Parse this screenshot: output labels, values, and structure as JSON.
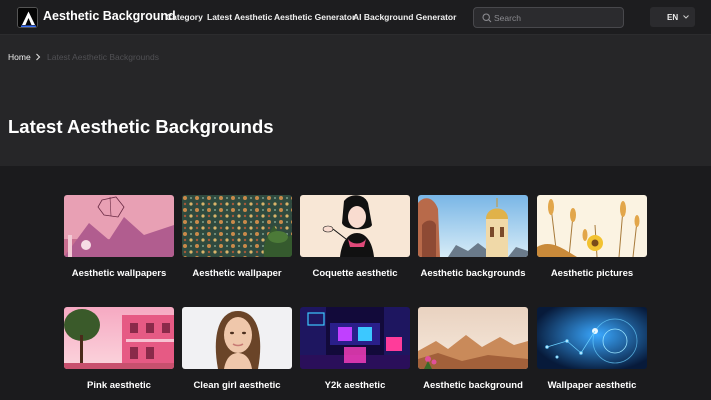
{
  "header": {
    "logo_name": "Aesthetic Background",
    "nav": [
      "Category",
      "Latest Aesthetic",
      "Aesthetic Generator",
      "AI Background Generator"
    ],
    "search_placeholder": "Search",
    "language": "EN"
  },
  "breadcrumb": {
    "home": "Home",
    "current": "Latest Aesthetic Backgrounds"
  },
  "page_title": "Latest Aesthetic Backgrounds",
  "cards": [
    {
      "title": "Aesthetic wallpapers",
      "thumb": "pink-crystal-room"
    },
    {
      "title": "Aesthetic wallpaper",
      "thumb": "floral-pattern-wall"
    },
    {
      "title": "Coquette aesthetic",
      "thumb": "coquette-girl-sketch"
    },
    {
      "title": "Aesthetic backgrounds",
      "thumb": "golden-domes"
    },
    {
      "title": "Aesthetic pictures",
      "thumb": "dried-flowers"
    },
    {
      "title": "Pink aesthetic",
      "thumb": "pink-houses"
    },
    {
      "title": "Clean girl aesthetic",
      "thumb": "girl-portrait"
    },
    {
      "title": "Y2k aesthetic",
      "thumb": "neon-room"
    },
    {
      "title": "Aesthetic background",
      "thumb": "desert-hills"
    },
    {
      "title": "Wallpaper aesthetic",
      "thumb": "blue-tech-circuit"
    }
  ]
}
